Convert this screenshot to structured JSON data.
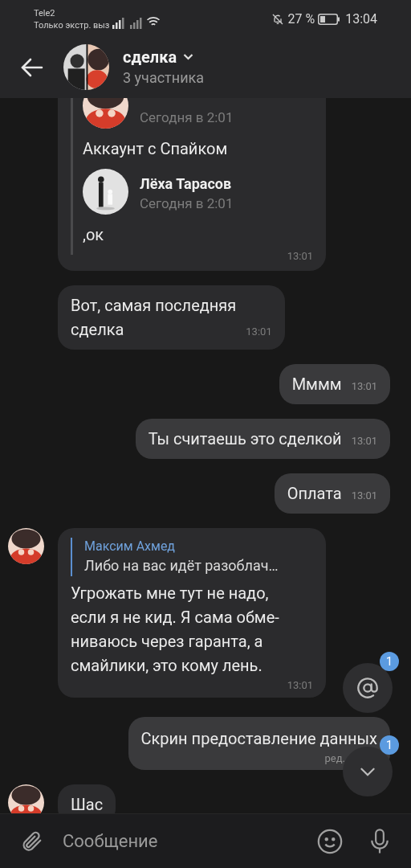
{
  "status_bar": {
    "carrier": "Tele2",
    "carrier_status": "Только экстр. выз",
    "battery_percent": "27 %",
    "time": "13:04"
  },
  "header": {
    "title": "сделка",
    "subtitle": "3 участника"
  },
  "messages": [
    {
      "kind": "forward",
      "outgoing": false,
      "avatar": false,
      "forwards": [
        {
          "time": "Сегодня в 2:01",
          "text": "Аккаунт с Спайком"
        },
        {
          "name": "Лёха Тарасов",
          "time": "Сегодня в 2:01",
          "text": ",ок"
        }
      ],
      "time": "13:01"
    },
    {
      "kind": "text",
      "outgoing": false,
      "avatar": false,
      "lines": [
        "Вот, самая последняя",
        "сделка"
      ],
      "time": "13:01"
    },
    {
      "kind": "text",
      "outgoing": true,
      "avatar": false,
      "lines": [
        "Мммм"
      ],
      "time": "13:01"
    },
    {
      "kind": "text",
      "outgoing": true,
      "avatar": false,
      "lines": [
        "Ты считаешь это сделкой"
      ],
      "time": "13:01"
    },
    {
      "kind": "text",
      "outgoing": true,
      "avatar": false,
      "lines": [
        "Оплата"
      ],
      "time": "13:01"
    },
    {
      "kind": "reply",
      "outgoing": false,
      "avatar": true,
      "reply_name": "Максим Ахмед",
      "reply_text": "Либо на вас идёт разоблач…",
      "lines": [
        "Угрожать мне тут не надо,",
        "если я не кид. Я сама обме-",
        "ниваюсь через гаранта, а",
        "смайлики, это кому лень."
      ],
      "time": "13:01"
    },
    {
      "kind": "edited",
      "outgoing": true,
      "avatar": false,
      "lines": [
        "Скрин предоставление данных"
      ],
      "edited_label": "ред."
    },
    {
      "kind": "text",
      "outgoing": false,
      "avatar": true,
      "lines": [
        "Шас"
      ]
    }
  ],
  "floating_buttons": [
    {
      "kind": "mention",
      "badge": "1"
    },
    {
      "kind": "scroll_down",
      "badge": "1"
    }
  ],
  "composer": {
    "placeholder": "Сообщение"
  }
}
